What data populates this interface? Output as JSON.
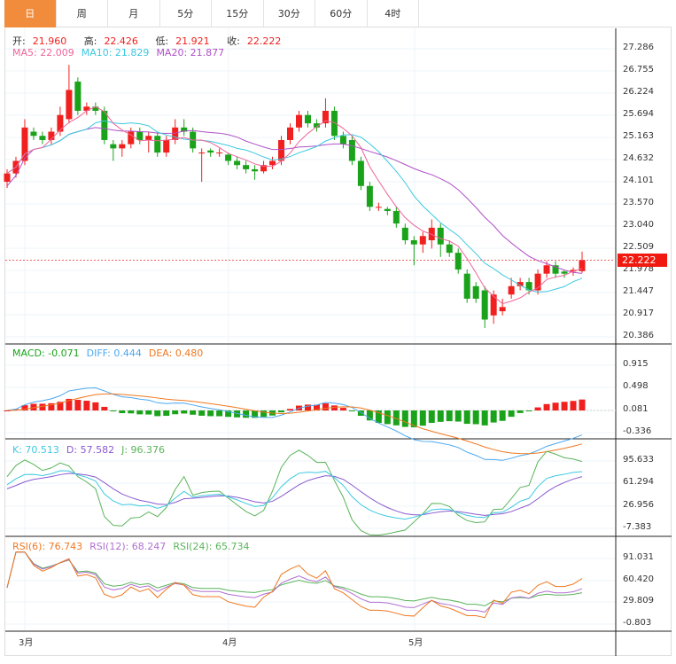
{
  "tabs": [
    "日",
    "周",
    "月",
    "5分",
    "15分",
    "30分",
    "60分",
    "4时"
  ],
  "active_tab": 0,
  "ohlc": {
    "open_label": "开:",
    "open": "21.960",
    "high_label": "高:",
    "high": "22.426",
    "low_label": "低:",
    "low": "21.921",
    "close_label": "收:",
    "close": "22.222"
  },
  "ma": {
    "ma5": "MA5: 22.009",
    "ma10": "MA10: 21.829",
    "ma20": "MA20: 21.877"
  },
  "macd": {
    "macd": "MACD: -0.071",
    "diff": "DIFF: 0.444",
    "dea": "DEA: 0.480"
  },
  "kdj": {
    "k": "K: 70.513",
    "d": "D: 57.582",
    "j": "J: 96.376"
  },
  "rsi": {
    "r6": "RSI(6): 76.743",
    "r12": "RSI(12): 68.247",
    "r24": "RSI(24): 65.734"
  },
  "price_axis": [
    "27.286",
    "26.755",
    "26.224",
    "25.694",
    "25.163",
    "24.632",
    "24.101",
    "23.570",
    "23.040",
    "22.509",
    "21.978",
    "21.447",
    "20.917",
    "20.386"
  ],
  "current_price": "22.222",
  "macd_axis": [
    "0.915",
    "0.498",
    "0.081",
    "-0.336"
  ],
  "kdj_axis": [
    "95.633",
    "61.294",
    "26.956",
    "-7.383"
  ],
  "rsi_axis": [
    "91.031",
    "60.420",
    "29.809",
    "-0.803"
  ],
  "months": [
    "3月",
    "4月",
    "5月"
  ],
  "colors": {
    "up": "#f0201e",
    "down": "#1aa31a",
    "ma5": "#f0649a",
    "ma10": "#3cc8e0",
    "ma20": "#b050c8",
    "diff": "#4aa8f0",
    "dea": "#f07820",
    "k": "#3cc8e0",
    "d": "#8a5ad0",
    "j": "#5ab45a"
  },
  "chart_data": {
    "type": "candlestick",
    "candles": [
      [
        24.1,
        24.4,
        23.95,
        24.3
      ],
      [
        24.3,
        24.7,
        24.2,
        24.6
      ],
      [
        24.6,
        25.6,
        24.5,
        25.4
      ],
      [
        25.3,
        25.4,
        25.1,
        25.2
      ],
      [
        25.2,
        25.3,
        25.0,
        25.1
      ],
      [
        25.1,
        25.4,
        25.0,
        25.3
      ],
      [
        25.3,
        25.9,
        25.2,
        25.7
      ],
      [
        25.6,
        26.9,
        25.5,
        26.3
      ],
      [
        26.5,
        26.6,
        25.7,
        25.8
      ],
      [
        25.8,
        26.0,
        25.7,
        25.9
      ],
      [
        25.9,
        26.0,
        25.7,
        25.8
      ],
      [
        25.8,
        25.9,
        25.0,
        25.1
      ],
      [
        25.0,
        25.1,
        24.6,
        24.9
      ],
      [
        24.9,
        25.1,
        24.7,
        25.0
      ],
      [
        25.0,
        25.4,
        24.9,
        25.3
      ],
      [
        25.3,
        25.4,
        25.0,
        25.1
      ],
      [
        25.1,
        25.3,
        24.8,
        25.2
      ],
      [
        25.2,
        25.3,
        24.7,
        24.8
      ],
      [
        24.8,
        25.2,
        24.7,
        25.1
      ],
      [
        25.1,
        25.6,
        25.0,
        25.4
      ],
      [
        25.4,
        25.6,
        25.2,
        25.3
      ],
      [
        25.3,
        25.4,
        24.8,
        24.9
      ],
      [
        24.8,
        24.9,
        24.1,
        24.8
      ],
      [
        24.85,
        24.9,
        24.7,
        24.8
      ],
      [
        24.8,
        24.9,
        24.7,
        24.8
      ],
      [
        24.75,
        24.8,
        24.5,
        24.6
      ],
      [
        24.6,
        24.7,
        24.4,
        24.5
      ],
      [
        24.5,
        24.6,
        24.3,
        24.4
      ],
      [
        24.4,
        24.5,
        24.15,
        24.35
      ],
      [
        24.35,
        24.6,
        24.3,
        24.5
      ],
      [
        24.5,
        24.7,
        24.4,
        24.6
      ],
      [
        24.6,
        25.2,
        24.5,
        25.1
      ],
      [
        25.1,
        25.5,
        25.0,
        25.4
      ],
      [
        25.4,
        25.8,
        25.3,
        25.7
      ],
      [
        25.7,
        25.8,
        25.4,
        25.5
      ],
      [
        25.5,
        25.6,
        25.3,
        25.4
      ],
      [
        25.5,
        26.1,
        25.4,
        25.8
      ],
      [
        25.8,
        25.9,
        25.1,
        25.2
      ],
      [
        25.2,
        25.3,
        24.9,
        25.0
      ],
      [
        25.1,
        25.2,
        24.5,
        24.6
      ],
      [
        24.6,
        24.7,
        23.9,
        24.0
      ],
      [
        24.0,
        24.1,
        23.4,
        23.5
      ],
      [
        23.5,
        23.6,
        23.4,
        23.5
      ],
      [
        23.45,
        23.5,
        23.3,
        23.4
      ],
      [
        23.4,
        23.5,
        23.0,
        23.1
      ],
      [
        23.0,
        23.1,
        22.6,
        22.7
      ],
      [
        22.7,
        22.8,
        22.1,
        22.6
      ],
      [
        22.6,
        22.9,
        22.4,
        22.8
      ],
      [
        22.7,
        23.2,
        22.5,
        23.0
      ],
      [
        23.0,
        23.1,
        22.3,
        22.6
      ],
      [
        22.6,
        22.7,
        22.3,
        22.4
      ],
      [
        22.4,
        22.5,
        21.9,
        22.0
      ],
      [
        21.9,
        22.0,
        21.2,
        21.3
      ],
      [
        21.6,
        21.7,
        21.2,
        21.3
      ],
      [
        21.5,
        21.6,
        20.6,
        20.8
      ],
      [
        20.9,
        21.5,
        20.7,
        21.4
      ],
      [
        21.0,
        21.3,
        20.9,
        21.1
      ],
      [
        21.4,
        21.8,
        21.3,
        21.6
      ],
      [
        21.6,
        21.8,
        21.5,
        21.7
      ],
      [
        21.7,
        21.8,
        21.4,
        21.5
      ],
      [
        21.5,
        22.0,
        21.4,
        21.9
      ],
      [
        21.9,
        22.2,
        21.8,
        22.1
      ],
      [
        22.1,
        22.2,
        21.8,
        21.9
      ],
      [
        21.95,
        22.0,
        21.8,
        21.9
      ],
      [
        21.95,
        22.05,
        21.85,
        21.99
      ],
      [
        21.96,
        22.426,
        21.921,
        22.222
      ]
    ]
  }
}
